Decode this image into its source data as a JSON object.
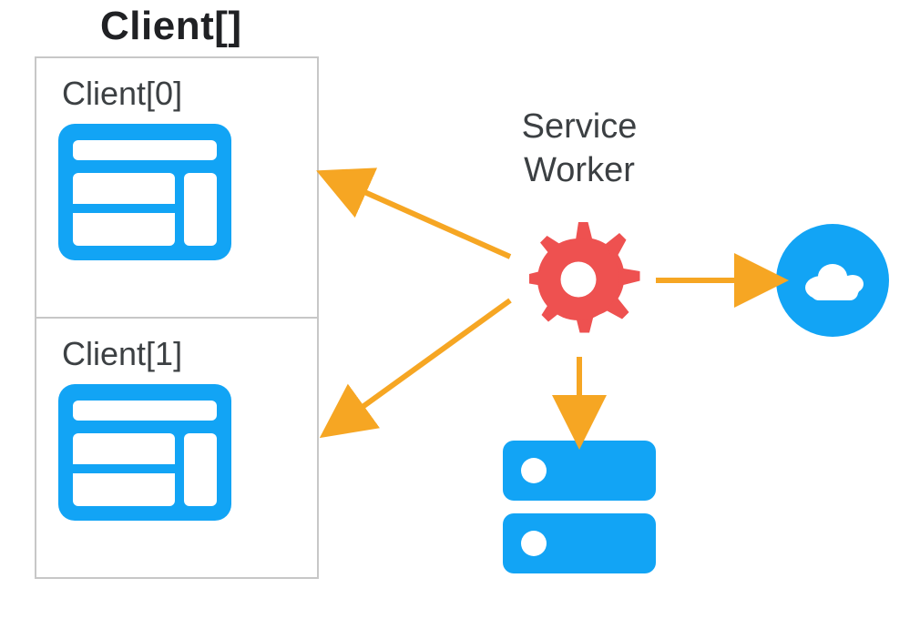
{
  "title": "Client[]",
  "clients": [
    {
      "label": "Client[0]"
    },
    {
      "label": "Client[1]"
    }
  ],
  "serviceWorker": {
    "label": "Service\nWorker"
  },
  "colors": {
    "blue": "#12a4f5",
    "red": "#ee5150",
    "arrow": "#f6a623",
    "border": "#c7c7c7",
    "text": "#3c4043"
  },
  "diagram": {
    "nodes": [
      {
        "id": "clients_array",
        "type": "group",
        "label": "Client[]"
      },
      {
        "id": "client0",
        "type": "browser-window",
        "label": "Client[0]"
      },
      {
        "id": "client1",
        "type": "browser-window",
        "label": "Client[1]"
      },
      {
        "id": "service_worker",
        "type": "gear",
        "label": "Service Worker"
      },
      {
        "id": "local_storage",
        "type": "server-stack"
      },
      {
        "id": "network_cloud",
        "type": "cloud"
      }
    ],
    "edges": [
      {
        "from": "service_worker",
        "to": "client0",
        "direction": "bidirectional"
      },
      {
        "from": "service_worker",
        "to": "client1",
        "direction": "bidirectional"
      },
      {
        "from": "service_worker",
        "to": "local_storage",
        "direction": "to"
      },
      {
        "from": "service_worker",
        "to": "network_cloud",
        "direction": "to"
      }
    ]
  }
}
